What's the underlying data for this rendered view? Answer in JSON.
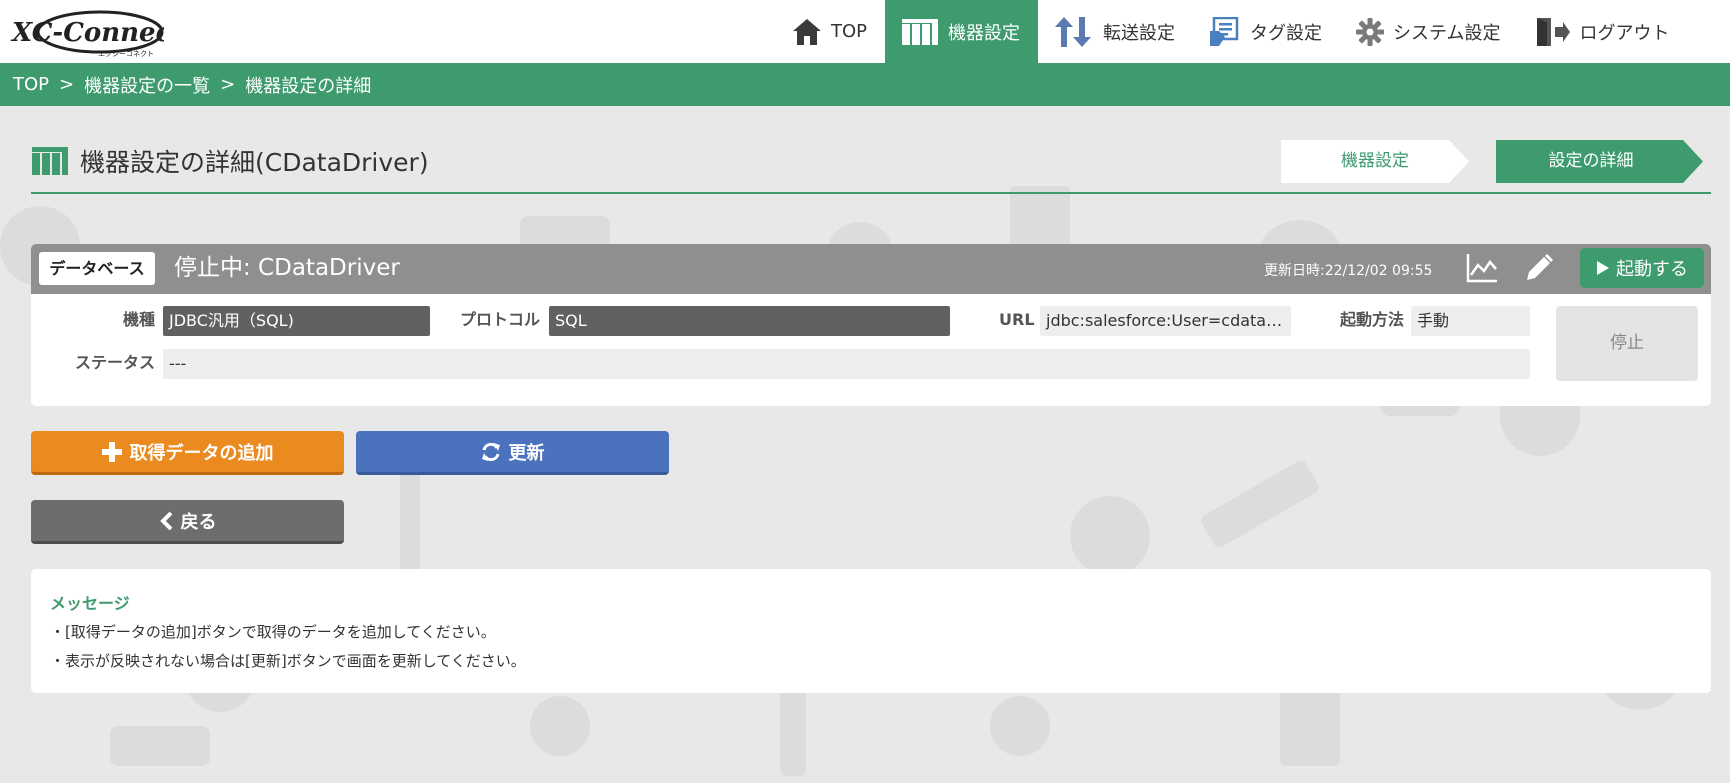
{
  "header": {
    "logo_text": "XC-Connect",
    "logo_sub": "エクシーコネクト",
    "nav": [
      {
        "label": "TOP",
        "icon": "home-icon",
        "active": false
      },
      {
        "label": "機器設定",
        "icon": "device-icon",
        "active": true
      },
      {
        "label": "転送設定",
        "icon": "transfer-icon",
        "active": false
      },
      {
        "label": "タグ設定",
        "icon": "tag-icon",
        "active": false
      },
      {
        "label": "システム設定",
        "icon": "gear-icon",
        "active": false
      },
      {
        "label": "ログアウト",
        "icon": "logout-icon",
        "active": false
      }
    ]
  },
  "breadcrumb": {
    "items": [
      "TOP",
      "機器設定の一覧",
      "機器設定の詳細"
    ],
    "separator": ">"
  },
  "page": {
    "title": "機器設定の詳細(CDataDriver)",
    "steps": [
      "機器設定",
      "設定の詳細"
    ]
  },
  "device": {
    "type_badge": "データベース",
    "status_name": "停止中: CDataDriver",
    "updated": "更新日時:22/12/02 09:55",
    "start_label": "起動する",
    "fields": {
      "model_label": "機種",
      "model_value": "JDBC汎用（SQL)",
      "protocol_label": "プロトコル",
      "protocol_value": "SQL",
      "url_label": "URL",
      "url_value": "jdbc:salesforce:User=cdata…",
      "startup_label": "起動方法",
      "startup_value": "手動",
      "status_label": "ステータス",
      "status_value": "---"
    },
    "stop_label": "停止"
  },
  "actions": {
    "add_label": "取得データの追加",
    "refresh_label": "更新",
    "back_label": "戻る"
  },
  "message": {
    "title": "メッセージ",
    "lines": [
      "・[取得データの追加]ボタンで取得のデータを追加してください。",
      "・表示が反映されない場合は[更新]ボタンで画面を更新してください。"
    ]
  },
  "colors": {
    "accent": "#3d9b6e",
    "add": "#ea8a1f",
    "refresh": "#4a72bd",
    "back": "#6d6d6d"
  }
}
